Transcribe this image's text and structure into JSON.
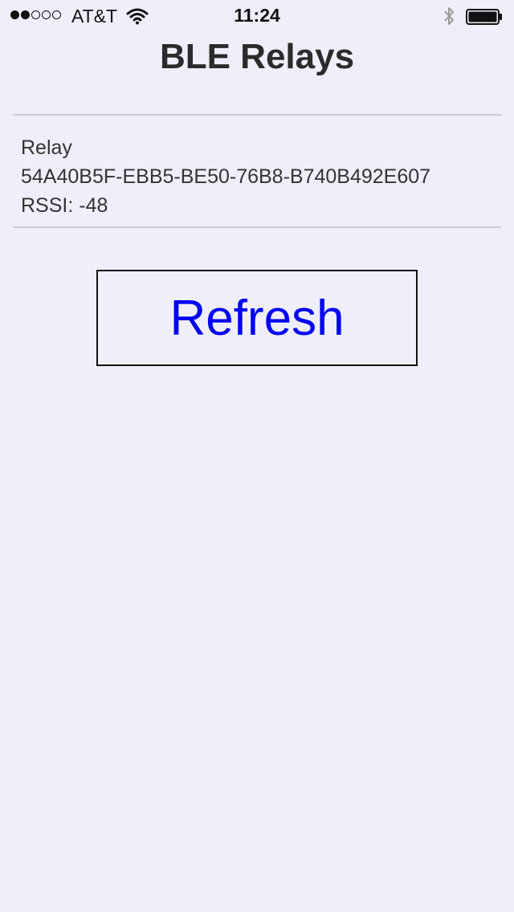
{
  "status_bar": {
    "signal_dots": {
      "filled": 2,
      "total": 5
    },
    "carrier": "AT&T",
    "time": "11:24",
    "icons": [
      "wifi-icon",
      "bluetooth-icon",
      "battery-icon"
    ]
  },
  "header": {
    "title": "BLE Relays"
  },
  "relays": [
    {
      "name": "Relay",
      "uuid": "54A40B5F-EBB5-BE50-76B8-B740B492E607",
      "rssi": "RSSI: -48"
    }
  ],
  "actions": {
    "refresh_label": "Refresh"
  },
  "colors": {
    "background": "#efeffb",
    "button_text": "#0000f5",
    "divider": "#cdcdd3"
  }
}
